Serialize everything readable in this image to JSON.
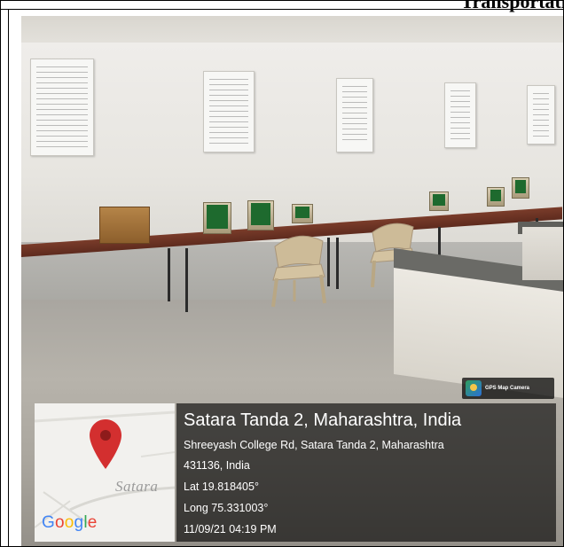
{
  "document": {
    "heading_fragment": "Transportati"
  },
  "photo": {
    "badge": {
      "icon": "gps-map-camera-icon",
      "label": "GPS Map Camera"
    },
    "map": {
      "place_label": "Satara",
      "provider": "Google",
      "pin_icon": "map-pin-icon",
      "pin_color": "#d32f2f"
    },
    "location": {
      "title": "Satara Tanda 2, Maharashtra, India",
      "address_line1": "Shreeyash College Rd, Satara Tanda 2, Maharashtra",
      "address_line2": "431136, India",
      "latitude": "Lat 19.818405°",
      "longitude": "Long 75.331003°",
      "timestamp": "11/09/21 04:19 PM"
    }
  }
}
